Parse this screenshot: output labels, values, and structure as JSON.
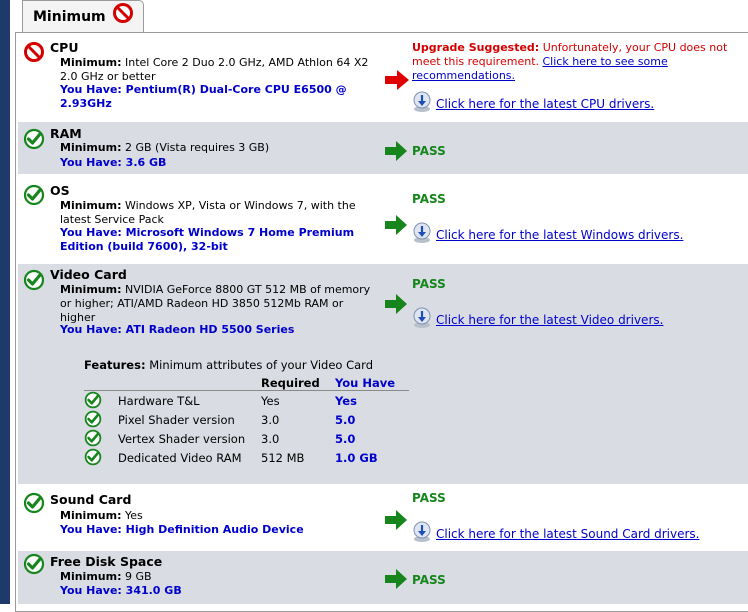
{
  "tab": {
    "label": "Minimum"
  },
  "colors": {
    "pass": "#16861c",
    "warn": "#d40000",
    "link": "#0000cc",
    "row_gray": "#d9dce3"
  },
  "rows": {
    "cpu": {
      "title": "CPU",
      "min_label": "Minimum:",
      "min_text": "Intel Core 2 Duo 2.0 GHz, AMD Athlon 64 X2 2.0 GHz or better",
      "have_text": "You Have: Pentium(R) Dual-Core CPU E6500 @ 2.93GHz",
      "upgrade_label": "Upgrade Suggested:",
      "upgrade_text": " Unfortunately, your CPU does not meet this requirement. ",
      "upgrade_link": "Click here to see some recommendations.",
      "driver_link": "Click here for the latest CPU drivers."
    },
    "ram": {
      "title": "RAM",
      "min_label": "Minimum:",
      "min_text": "2 GB (Vista requires 3 GB)",
      "have_text": "You Have: 3.6 GB",
      "status": "PASS"
    },
    "os": {
      "title": "OS",
      "min_label": "Minimum:",
      "min_text": "Windows XP, Vista or Windows 7, with the latest Service Pack",
      "have_text": "You Have: Microsoft Windows 7 Home Premium Edition (build 7600), 32-bit",
      "status": "PASS",
      "driver_link": "Click here for the latest Windows drivers."
    },
    "video": {
      "title": "Video Card",
      "min_label": "Minimum:",
      "min_text": "NVIDIA GeForce 8800 GT 512 MB of memory or higher; ATI/AMD Radeon HD 3850 512Mb RAM or higher",
      "have_text": "You Have: ATI Radeon HD 5500 Series",
      "status": "PASS",
      "driver_link": "Click here for the latest Video drivers.",
      "features_label": "Features:",
      "features_text": "Minimum attributes of your Video Card",
      "col_required": "Required",
      "col_have": "You Have",
      "features": [
        {
          "name": "Hardware T&L",
          "required": "Yes",
          "have": "Yes"
        },
        {
          "name": "Pixel Shader version",
          "required": "3.0",
          "have": "5.0"
        },
        {
          "name": "Vertex Shader version",
          "required": "3.0",
          "have": "5.0"
        },
        {
          "name": "Dedicated Video RAM",
          "required": "512 MB",
          "have": "1.0 GB"
        }
      ]
    },
    "sound": {
      "title": "Sound Card",
      "min_label": "Minimum:",
      "min_text": "Yes",
      "have_text": "You Have: High Definition Audio Device",
      "status": "PASS",
      "driver_link": "Click here for the latest Sound Card drivers."
    },
    "disk": {
      "title": "Free Disk Space",
      "min_label": "Minimum:",
      "min_text": "9 GB",
      "have_text": "You Have: 341.0 GB",
      "status": "PASS"
    }
  }
}
